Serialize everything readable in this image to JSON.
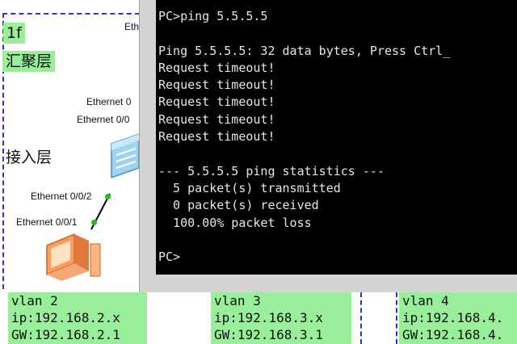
{
  "diagram": {
    "floor_label": "1f",
    "aggregation_layer_label": "汇聚层",
    "access_layer_label": "接入层",
    "ports": {
      "top_cut": "Eth",
      "switch_upper_1": "Ethernet 0",
      "switch_upper_2": "Ethernet 0/0",
      "switch_lower": "Ethernet 0/0/2",
      "pc_port": "Ethernet 0/0/1"
    },
    "vlans": [
      {
        "name": "vlan 2",
        "ip": "ip:192.168.2.x",
        "gw": "GW:192.168.2.1"
      },
      {
        "name": "vlan 3",
        "ip": "ip:192.168.3.x",
        "gw": "GW:192.168.3.1"
      },
      {
        "name": "vlan 4",
        "ip": "ip:192.168.4.",
        "gw": "GW:192.168.4."
      }
    ],
    "colors": {
      "label_bg": "#99ee99",
      "boundary": "#3333cc",
      "port_dot": "#22bb22"
    }
  },
  "terminal": {
    "lines": [
      "PC>ping 5.5.5.5",
      "",
      "Ping 5.5.5.5: 32 data bytes, Press Ctrl_",
      "Request timeout!",
      "Request timeout!",
      "Request timeout!",
      "Request timeout!",
      "Request timeout!",
      "",
      "--- 5.5.5.5 ping statistics ---",
      "  5 packet(s) transmitted",
      "  0 packet(s) received",
      "  100.00% packet loss",
      "",
      "PC>"
    ],
    "colors": {
      "background": "#000000",
      "text": "#e6e6e6",
      "frame": "#d4d4d4"
    }
  }
}
